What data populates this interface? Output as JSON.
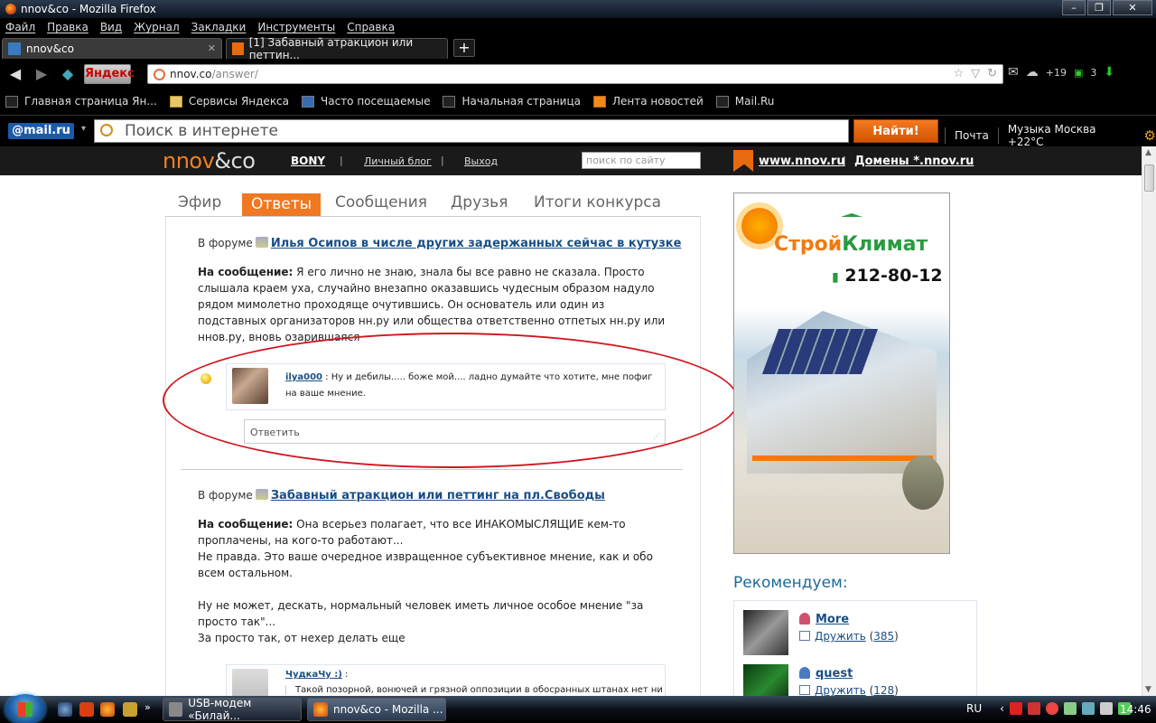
{
  "window": {
    "title": "nnov&co - Mozilla Firefox"
  },
  "menu": [
    "Файл",
    "Правка",
    "Вид",
    "Журнал",
    "Закладки",
    "Инструменты",
    "Справка"
  ],
  "tabs": [
    {
      "label": "nnov&co",
      "active": true
    },
    {
      "label": "[1] Забавный атракцион или петтин...",
      "active": false
    }
  ],
  "nav": {
    "yandex": "Яндекс",
    "url_host": "nnov.co",
    "url_path": "/answer/",
    "mail_count": "+19",
    "dl_count": "3"
  },
  "bookmarks": [
    "Главная страница Ян...",
    "Сервисы Яндекса",
    "Часто посещаемые",
    "Начальная страница",
    "Лента новостей",
    "Mail.Ru"
  ],
  "mailbar": {
    "logo": "@mail.ru",
    "placeholder": "Поиск в интернете",
    "find": "Найти!",
    "mail": "Почта",
    "music": "Музыка Москва +22°C"
  },
  "site": {
    "logo_a": "nnov",
    "logo_b": "&co",
    "user": "BONY",
    "blog": "Личный блог",
    "logout": "Выход",
    "search_placeholder": "поиск по сайту",
    "link1": "www.nnov.ru",
    "link2": "Домены *.nnov.ru"
  },
  "tabs_nav": [
    "Эфир",
    "Ответы",
    "Сообщения",
    "Друзья",
    "Итоги конкурса"
  ],
  "posts": [
    {
      "forum_prefix": "В форуме",
      "forum_title": "Илья Осипов в числе других задержанных сейчас в кутузке",
      "msg_label": "На сообщение:",
      "msg_text": "Я его лично не знаю, знала бы все равно не сказала. Просто слышала краем уха, случайно внезапно оказавшись чудесным образом надуло рядом мимолетно проходяще очутившись. Он основатель или один из подставных организаторов нн.ру или общества ответственно отпетых нн.ру или ннов.ру, вновь озарившаяся",
      "comment_author": "ilya000",
      "comment_text": " : Ну и дебилы..... боже мой.... ладно думайте что хотите, мне пофиг на ваше мнение.",
      "reply": "Ответить"
    },
    {
      "forum_prefix": "В форуме",
      "forum_title": "Забавный атракцион или петтинг на пл.Свободы",
      "msg_label": "На сообщение:",
      "msg_text": "Она всерьез полагает, что все ИНАКОМЫСЛЯЩИЕ кем-то\nпроплачены, на кого-то работают...\nНе правда. Это ваше очередное извращенное субъективное мнение, как и обо всем остальном.\n\nНу не может, дескать, нормальный человек иметь личное особое мнение \"за просто так\"...\nЗа просто так, от нехер делать еще",
      "comment_author": "ЧудкаЧу :)",
      "comment_text": " :",
      "comment_sub": "Такой позорной, вонючей и грязной оппозиции в обосранных штанах нет ни"
    }
  ],
  "ad": {
    "brand_a": "Строй",
    "brand_b": "Климат",
    "phone": "212-80-12"
  },
  "recommend": {
    "title": "Рекомендуем:",
    "items": [
      {
        "name": "More",
        "friend": "Дружить",
        "count": "385"
      },
      {
        "name": "quest",
        "friend": "Дружить",
        "count": "128"
      }
    ]
  },
  "taskbar": {
    "buttons": [
      "USB-модем «Билай...",
      "nnov&co - Mozilla ..."
    ],
    "lang": "RU",
    "time": "14:46"
  }
}
